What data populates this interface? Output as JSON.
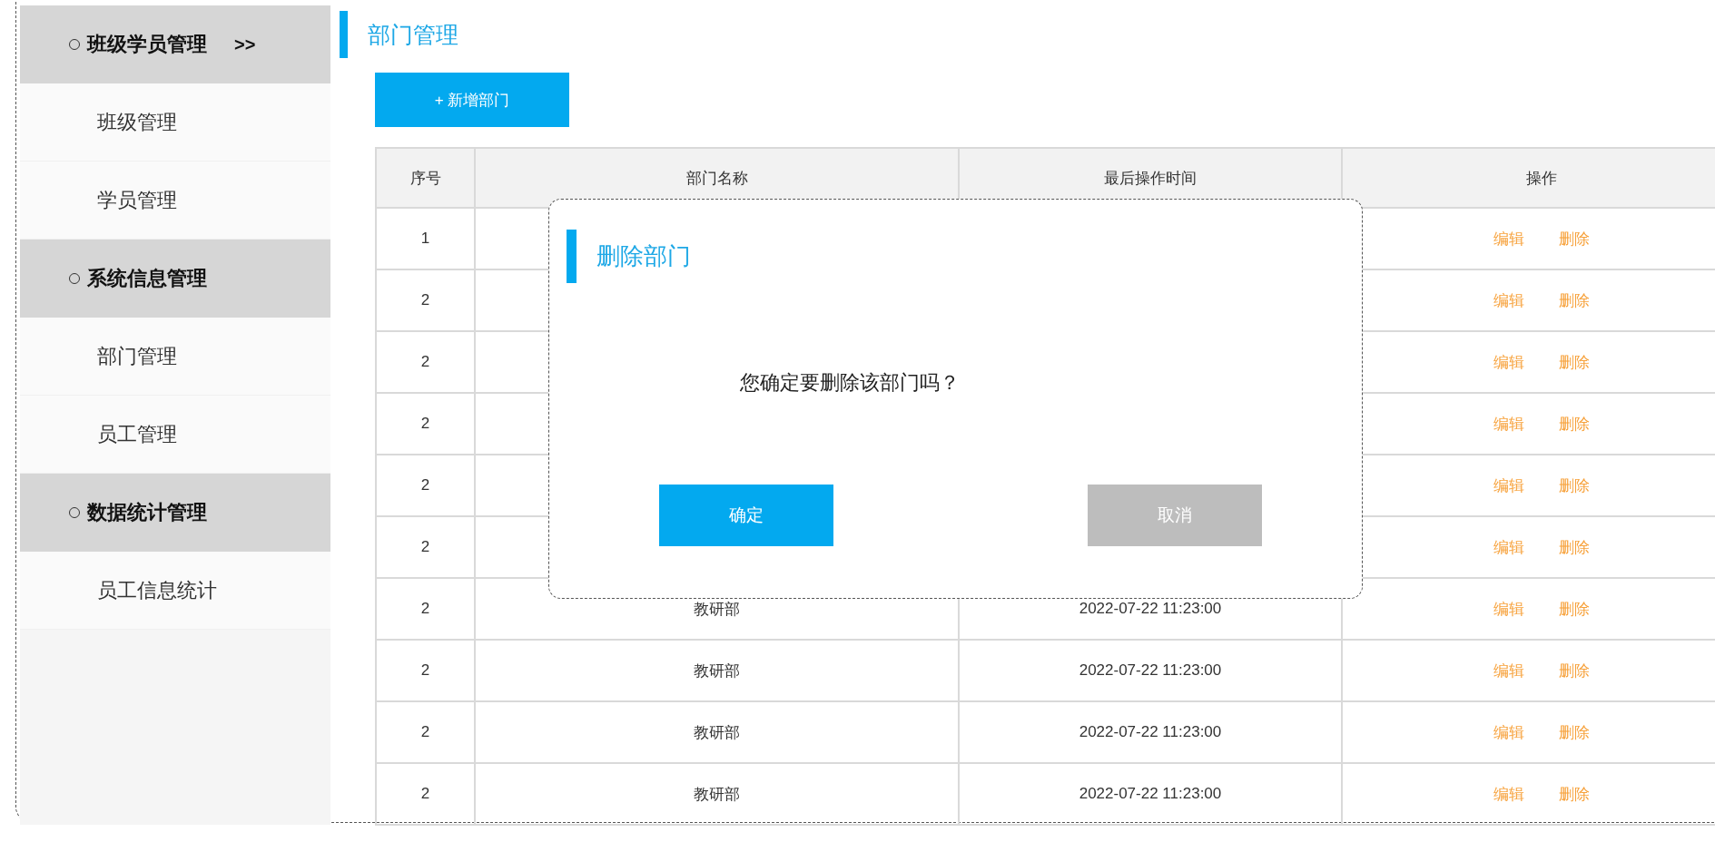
{
  "sidebar": {
    "groups": [
      {
        "title": "班级学员管理",
        "indicator": ">>",
        "items": [
          "班级管理",
          "学员管理"
        ]
      },
      {
        "title": "系统信息管理",
        "items": [
          "部门管理",
          "员工管理"
        ]
      },
      {
        "title": "数据统计管理",
        "items": [
          "员工信息统计"
        ]
      }
    ]
  },
  "page_title": "部门管理",
  "add_button": "+ 新增部门",
  "table": {
    "columns": [
      "序号",
      "部门名称",
      "最后操作时间",
      "操作"
    ],
    "rows": [
      {
        "index": "1",
        "actions": [
          "编辑",
          "删除"
        ]
      },
      {
        "index": "2",
        "actions": [
          "编辑",
          "删除"
        ]
      },
      {
        "index": "2",
        "actions": [
          "编辑",
          "删除"
        ]
      },
      {
        "index": "2",
        "actions": [
          "编辑",
          "删除"
        ]
      },
      {
        "index": "2",
        "actions": [
          "编辑",
          "删除"
        ]
      },
      {
        "index": "2",
        "actions": [
          "编辑",
          "删除"
        ]
      },
      {
        "index": "2",
        "name": "教研部",
        "time": "2022-07-22 11:23:00",
        "actions": [
          "编辑",
          "删除"
        ]
      },
      {
        "index": "2",
        "name": "教研部",
        "time": "2022-07-22 11:23:00",
        "actions": [
          "编辑",
          "删除"
        ]
      },
      {
        "index": "2",
        "name": "教研部",
        "time": "2022-07-22 11:23:00",
        "actions": [
          "编辑",
          "删除"
        ]
      },
      {
        "index": "2",
        "name": "教研部",
        "time": "2022-07-22 11:23:00",
        "actions": [
          "编辑",
          "删除"
        ]
      }
    ]
  },
  "dialog": {
    "title": "删除部门",
    "message": "您确定要删除该部门吗？",
    "buttons": [
      {
        "label": "确定",
        "kind": "primary"
      },
      {
        "label": "取消",
        "kind": "secondary"
      }
    ]
  }
}
